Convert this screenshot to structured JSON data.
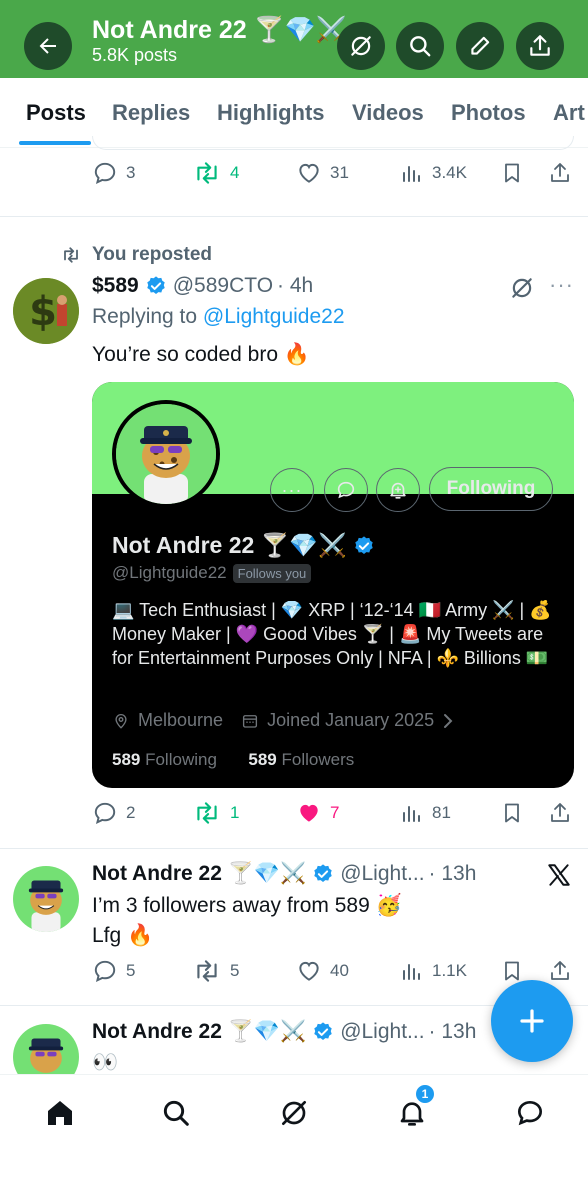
{
  "header": {
    "title": "Not Andre 22 🍸💎⚔️",
    "subtitle": "5.8K posts"
  },
  "tabs": [
    "Posts",
    "Replies",
    "Highlights",
    "Videos",
    "Photos",
    "Art"
  ],
  "top_post": {
    "replies": "3",
    "reposts": "4",
    "likes": "31",
    "views": "3.4K"
  },
  "repost_post": {
    "repost_label": "You reposted",
    "name": "$589",
    "handle": "@589CTO",
    "time": "· 4h",
    "replying_prefix": "Replying to ",
    "replying_to": "@Lightguide22",
    "text": "You’re so coded bro 🔥",
    "replies": "2",
    "reposts": "1",
    "likes": "7",
    "views": "81"
  },
  "profile_card": {
    "name": "Not Andre 22 🍸💎⚔️",
    "handle": "@Lightguide22",
    "follows_you": "Follows you",
    "follow_button": "Following",
    "bio": "💻 Tech Enthusiast | 💎 XRP | ‘12-‘14 🇮🇹 Army ⚔️ | 💰 Money Maker | 💜 Good Vibes 🍸 | 🚨 My Tweets are for Entertainment Purposes Only | NFA | ⚜️ Billions 💵",
    "location": "Melbourne",
    "joined": "Joined January 2025",
    "following_count": "589",
    "following_label": " Following",
    "followers_count": "589",
    "followers_label": " Followers"
  },
  "post_3": {
    "name": "Not Andre 22 🍸💎⚔️",
    "handle": "@Light...",
    "time": "· 13h",
    "line1": "I’m 3 followers away from 589 🥳",
    "line2": "Lfg 🔥",
    "replies": "5",
    "reposts": "5",
    "likes": "40",
    "views": "1.1K"
  },
  "post_4": {
    "name": "Not Andre 22 🍸💎⚔️",
    "handle": "@Light...",
    "time": "· 13h",
    "line1": "👀"
  },
  "bottom_nav": {
    "notification_count": "1"
  },
  "colors": {
    "header_bg": "#4aa84a",
    "accent": "#1d9bf0",
    "repost_green": "#00ba7c",
    "like_pink": "#f91880",
    "card_banner": "#7ef07e"
  },
  "icons": [
    "back-arrow-icon",
    "grok-icon",
    "search-icon",
    "compose-pencil-icon",
    "share-icon",
    "reply-icon",
    "repost-icon",
    "like-icon",
    "views-icon",
    "bookmark-icon",
    "verified-badge-icon",
    "x-logo-icon",
    "home-icon",
    "notifications-icon",
    "messages-icon",
    "plus-icon"
  ]
}
